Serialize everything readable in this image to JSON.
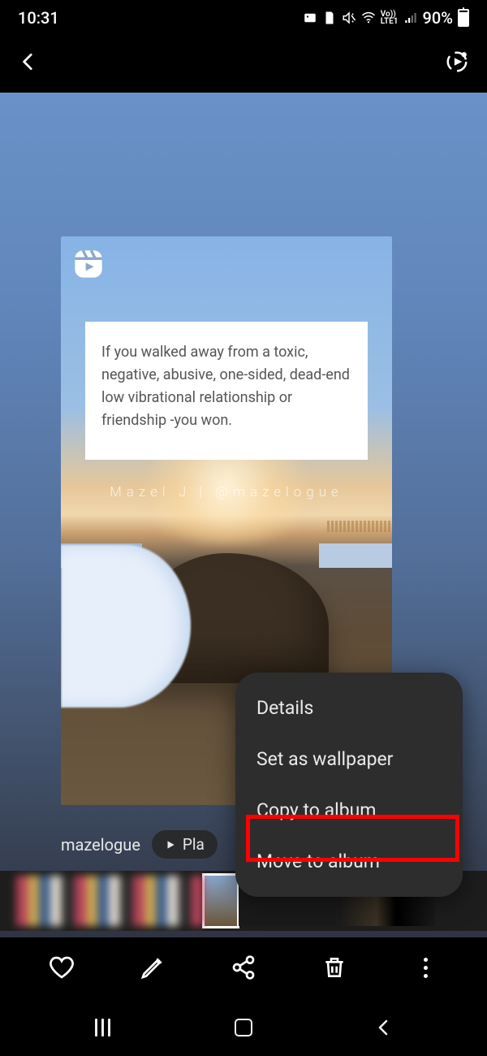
{
  "status": {
    "time": "10:31",
    "network_label": "Vo))\nLTE1",
    "battery_percent": "90%"
  },
  "quote": {
    "text": "If you walked away from a toxic, negative, abusive, one-sided, dead-end low vibrational relationship or friendship -you won.",
    "credit": "Mazel J | @mazelogue"
  },
  "caption": {
    "album": "mazelogue",
    "play_label": "Pla"
  },
  "menu": {
    "items": [
      "Details",
      "Set as wallpaper",
      "Copy to album",
      "Move to album"
    ],
    "highlighted_index": 1
  }
}
